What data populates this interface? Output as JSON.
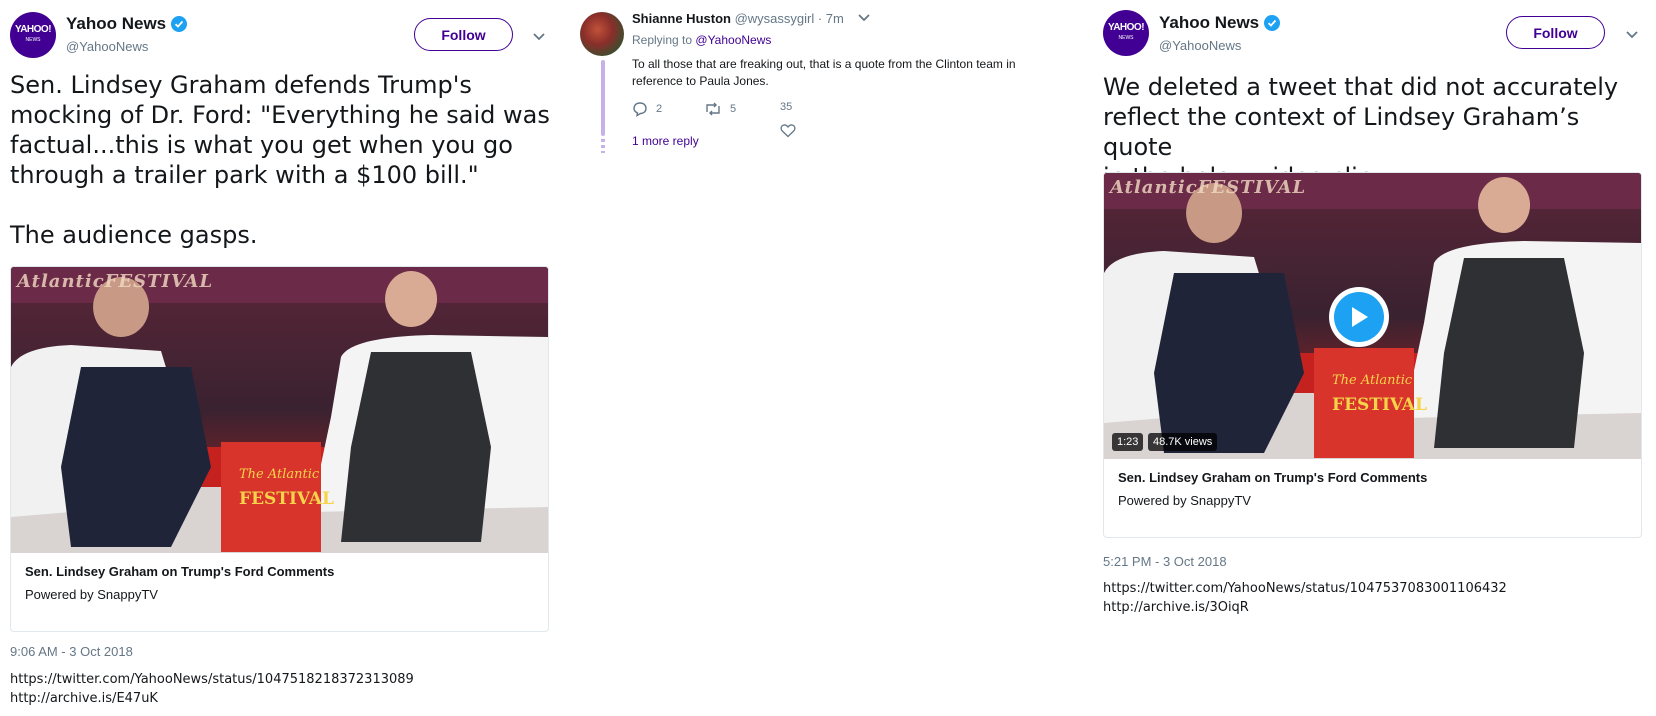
{
  "left_tweet": {
    "display_name": "Yahoo News",
    "handle": "@YahooNews",
    "avatar_text": "YAHOO!",
    "avatar_sub": "NEWS",
    "follow_label": "Follow",
    "text": "Sen. Lindsey Graham defends Trump's\nmocking of Dr. Ford: \"Everything he said was\nfactual...this is what you get when you go\nthrough a trailer park with a $100 bill.\"\n\nThe audience gasps.",
    "card_title": "Sen. Lindsey Graham on Trump's Ford Comments",
    "card_sub": "Powered by SnappyTV",
    "banner_text": "AtlanticFESTIVAL",
    "box_text_top": "The Atlantic",
    "box_text_bottom": "FESTIVAL",
    "timestamp": "9:06 AM - 3 Oct 2018",
    "links": [
      "https://twitter.com/YahooNews/status/1047518218372313089",
      "http://archive.is/E47uK"
    ]
  },
  "reply": {
    "display_name": "Shianne Huston",
    "handle": "@wysassygirl",
    "time": "· 7m",
    "replying_prefix": "Replying to",
    "replying_to": "@YahooNews",
    "text": "To all those that are freaking out, that is a quote from the Clinton team in reference to Paula Jones.",
    "reply_count": "2",
    "retweet_count": "5",
    "like_count": "35",
    "more_replies": "1 more reply"
  },
  "right_tweet": {
    "display_name": "Yahoo News",
    "handle": "@YahooNews",
    "avatar_text": "YAHOO!",
    "avatar_sub": "NEWS",
    "follow_label": "Follow",
    "text": "We deleted a tweet that did not accurately\nreflect the context of Lindsey Graham’s quote\nin the below video clip.",
    "duration": "1:23",
    "views": "48.7K views",
    "card_title": "Sen. Lindsey Graham on Trump's Ford Comments",
    "card_sub": "Powered by SnappyTV",
    "banner_text": "AtlanticFESTIVAL",
    "box_text_top": "The Atlantic",
    "box_text_bottom": "FESTIVAL",
    "timestamp": "5:21 PM - 3 Oct 2018",
    "links": [
      "https://twitter.com/YahooNews/status/1047537083001106432",
      "http://archive.is/3OiqR"
    ]
  },
  "colors": {
    "brand_purple": "#410093",
    "verified_blue": "#1da1f2",
    "muted": "#657786",
    "thread_line": "#c6b2e8"
  }
}
